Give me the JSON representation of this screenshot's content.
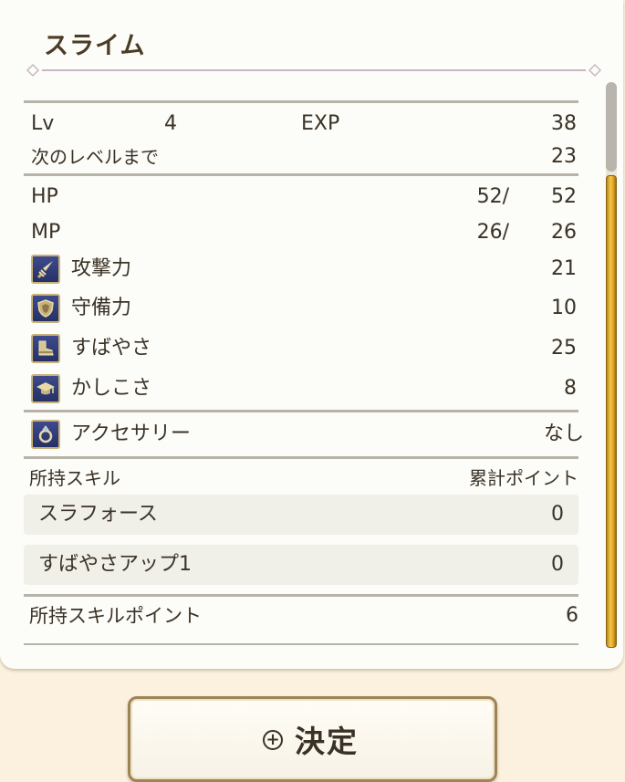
{
  "title": "スライム",
  "level": {
    "label": "Lv",
    "value": "4",
    "exp_label": "EXP",
    "exp_value": "38"
  },
  "next_level": {
    "label": "次のレベルまで",
    "value": "23"
  },
  "hp": {
    "label": "HP",
    "current": "52/",
    "max": "52"
  },
  "mp": {
    "label": "MP",
    "current": "26/",
    "max": "26"
  },
  "stats": [
    {
      "label": "攻撃力",
      "value": "21",
      "icon": "sword-icon"
    },
    {
      "label": "守備力",
      "value": "10",
      "icon": "shield-icon"
    },
    {
      "label": "すばやさ",
      "value": "25",
      "icon": "boot-icon"
    },
    {
      "label": "かしこさ",
      "value": "8",
      "icon": "graduation-cap-icon"
    }
  ],
  "accessory": {
    "label": "アクセサリー",
    "value": "なし",
    "icon": "ring-icon"
  },
  "skills": {
    "header_label": "所持スキル",
    "header_points_label": "累計ポイント",
    "items": [
      {
        "name": "スラフォース",
        "points": "0"
      },
      {
        "name": "すばやさアップ1",
        "points": "0"
      }
    ],
    "available_label": "所持スキルポイント",
    "available_value": "6"
  },
  "confirm_button": {
    "label": "決定",
    "icon": "plus-circle-icon"
  },
  "colors": {
    "panel_bg": "#fcfcf8",
    "page_bg": "#fbf1de",
    "icon_bg": "#2f3a78",
    "scrollbar_gold": "#e3a424"
  }
}
